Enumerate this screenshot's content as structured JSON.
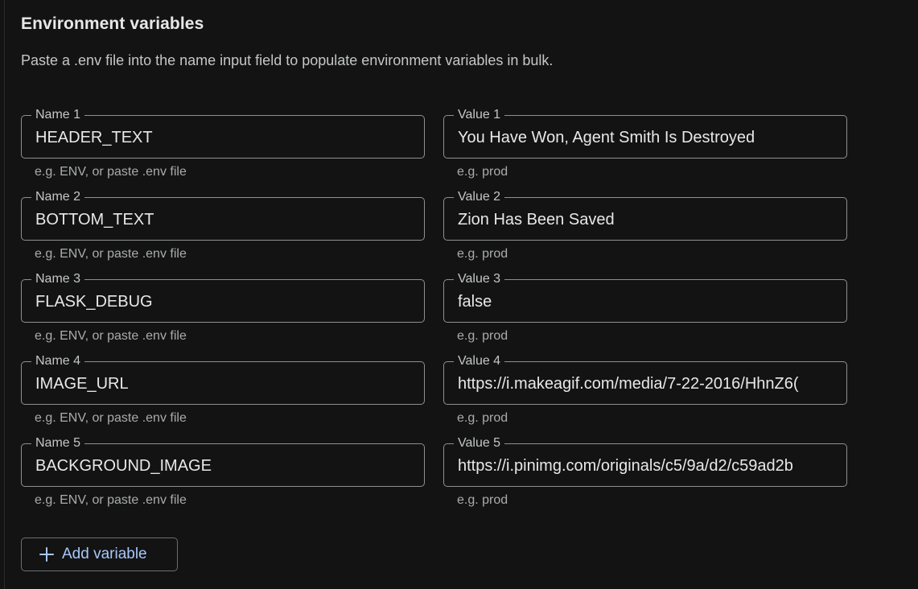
{
  "section": {
    "title": "Environment variables",
    "description": "Paste a .env file into the name input field to populate environment variables in bulk."
  },
  "variables": [
    {
      "name_label": "Name 1",
      "name_value": "HEADER_TEXT",
      "name_hint": "e.g. ENV, or paste .env file",
      "value_label": "Value 1",
      "value_value": "You Have Won, Agent Smith Is Destroyed",
      "value_hint": "e.g. prod"
    },
    {
      "name_label": "Name 2",
      "name_value": "BOTTOM_TEXT",
      "name_hint": "e.g. ENV, or paste .env file",
      "value_label": "Value 2",
      "value_value": "Zion Has Been Saved",
      "value_hint": "e.g. prod"
    },
    {
      "name_label": "Name 3",
      "name_value": "FLASK_DEBUG",
      "name_hint": "e.g. ENV, or paste .env file",
      "value_label": "Value 3",
      "value_value": "false",
      "value_hint": "e.g. prod"
    },
    {
      "name_label": "Name 4",
      "name_value": "IMAGE_URL",
      "name_hint": "e.g. ENV, or paste .env file",
      "value_label": "Value 4",
      "value_value": "https://i.makeagif.com/media/7-22-2016/HhnZ6(",
      "value_hint": "e.g. prod"
    },
    {
      "name_label": "Name 5",
      "name_value": "BACKGROUND_IMAGE",
      "name_hint": "e.g. ENV, or paste .env file",
      "value_label": "Value 5",
      "value_value": "https://i.pinimg.com/originals/c5/9a/d2/c59ad2b",
      "value_hint": "e.g. prod"
    }
  ],
  "add_button": {
    "label": "Add variable",
    "icon": "plus-icon"
  },
  "colors": {
    "background": "#131314",
    "field_border": "#8e918f",
    "accent": "#a8c7fa"
  }
}
